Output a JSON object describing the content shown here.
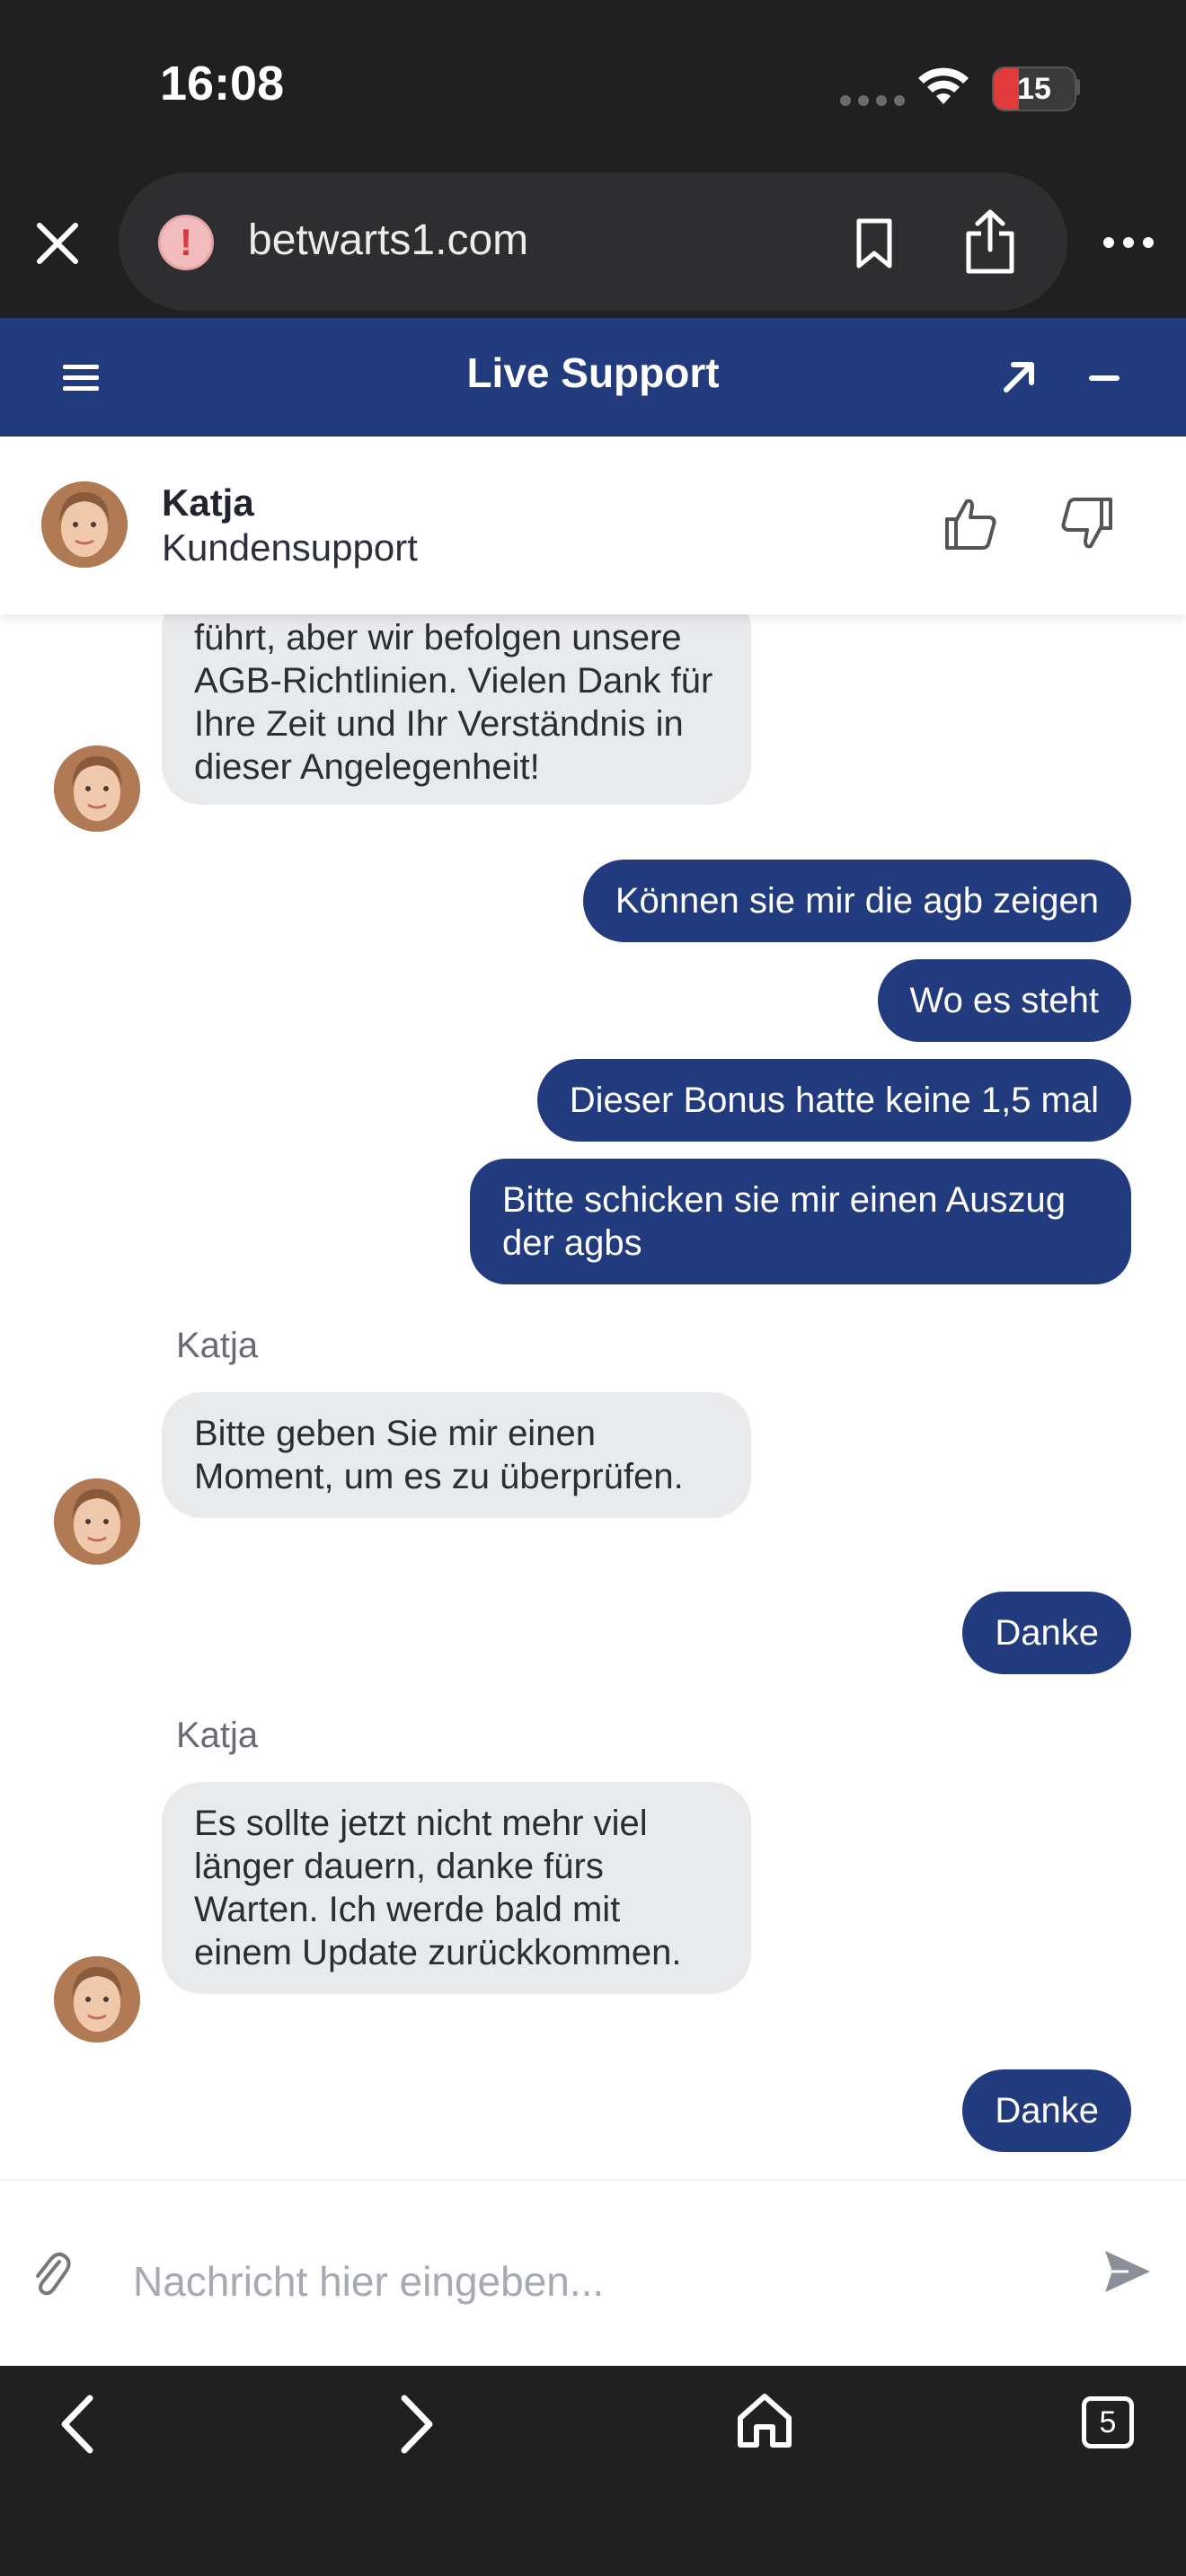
{
  "status_bar": {
    "time": "16:08",
    "battery": "15"
  },
  "browser": {
    "url": "betwarts1.com",
    "tab_count": "5"
  },
  "widget": {
    "title": "Live Support"
  },
  "agent": {
    "name": "Katja",
    "role": "Kundensupport"
  },
  "messages": [
    {
      "from": "agent",
      "text": "führt, aber wir befolgen unsere AGB-Richtlinien. Vielen Dank für Ihre Zeit und Ihr Verständnis in dieser Angelegenheit!"
    },
    {
      "from": "user",
      "text": "Können sie mir die agb zeigen"
    },
    {
      "from": "user",
      "text": "Wo es steht"
    },
    {
      "from": "user",
      "text": "Dieser Bonus hatte keine 1,5 mal"
    },
    {
      "from": "user",
      "text": "Bitte schicken sie mir einen Auszug der agbs"
    },
    {
      "from": "agent",
      "sender": "Katja",
      "text": "Bitte geben Sie mir einen Moment, um es zu überprüfen."
    },
    {
      "from": "user",
      "text": "Danke"
    },
    {
      "from": "agent",
      "sender": "Katja",
      "text": "Es sollte jetzt nicht mehr viel länger dauern, danke fürs Warten. Ich werde bald mit einem Update zurückkommen."
    },
    {
      "from": "user",
      "text": "Danke"
    }
  ],
  "composer": {
    "placeholder": "Nachricht hier eingeben..."
  },
  "colors": {
    "brand": "#223a7e",
    "agent_bubble": "#e9eaec",
    "browser_chrome": "#202020"
  },
  "icons": {
    "close": "close-icon",
    "warning": "warning-icon",
    "bookmark": "bookmark-icon",
    "share": "share-icon",
    "more": "more-icon",
    "menu": "hamburger-icon",
    "expand": "expand-icon",
    "minimize": "minimize-icon",
    "like": "thumbs-up-icon",
    "dislike": "thumbs-down-icon",
    "attach": "paperclip-icon",
    "send": "send-icon",
    "back": "back-icon",
    "forward": "forward-icon",
    "home": "home-icon",
    "tabs": "tabs-icon"
  }
}
